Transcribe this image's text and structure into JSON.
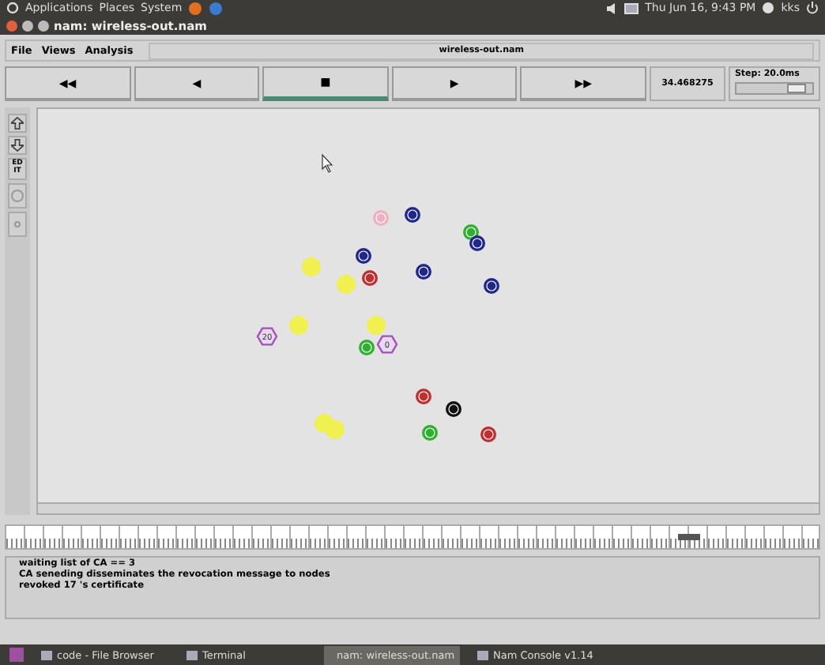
{
  "top_panel": {
    "menus": [
      "Applications",
      "Places",
      "System"
    ],
    "clock": "Thu Jun 16, 9:43 PM",
    "user": "kks"
  },
  "window": {
    "title": "nam: wireless-out.nam"
  },
  "menu_bar": {
    "items": [
      "File",
      "Views",
      "Analysis"
    ],
    "file_name": "wireless-out.nam"
  },
  "controls": [
    {
      "label": "◀◀",
      "selected": false
    },
    {
      "label": "◀",
      "selected": false
    },
    {
      "label": "■",
      "selected": true
    },
    {
      "label": "▶",
      "selected": false
    },
    {
      "label": "▶▶",
      "selected": false
    }
  ],
  "time": "34.468275",
  "step": {
    "label": "Step: 20.0ms",
    "level": 0.8
  },
  "side_tools": [
    {
      "kind": "zoom-in"
    },
    {
      "kind": "zoom-out"
    },
    {
      "kind": "edit",
      "label": "EDIT"
    },
    {
      "kind": "circle"
    },
    {
      "kind": "dot"
    }
  ],
  "nodes": [
    {
      "kind": "circle",
      "color": "#f0b0c0"
    },
    {
      "kind": "circle",
      "color": "#202890"
    },
    {
      "kind": "circle",
      "color": "#30b030"
    },
    {
      "kind": "circle",
      "color": "#202890"
    },
    {
      "kind": "circle",
      "color": "#202890"
    },
    {
      "kind": "circle",
      "color": "#c03030"
    },
    {
      "kind": "circle",
      "color": "#202890"
    },
    {
      "kind": "circle",
      "color": "#202890"
    },
    {
      "kind": "glow",
      "color": "#f0f050"
    },
    {
      "kind": "glow",
      "color": "#f0f050"
    },
    {
      "kind": "glow",
      "color": "#f0f050"
    },
    {
      "kind": "glow",
      "color": "#f0f050"
    },
    {
      "kind": "glow",
      "color": "#f0f050"
    },
    {
      "kind": "glow",
      "color": "#f0f050"
    },
    {
      "kind": "hexagon",
      "color": "#a050c0",
      "label": "20"
    },
    {
      "kind": "circle",
      "color": "#30b030"
    },
    {
      "kind": "hexagon",
      "color": "#a050c0",
      "label": "0"
    },
    {
      "kind": "circle",
      "color": "#c03030"
    },
    {
      "kind": "circle",
      "color": "#101010"
    },
    {
      "kind": "circle",
      "color": "#30b030"
    },
    {
      "kind": "circle",
      "color": "#c03030"
    }
  ],
  "timeline": {
    "level": 0.84
  },
  "log": [
    "waiting list of CA == 3",
    "CA seneding disseminates the revocation message to nodes",
    "revoked 17 's certificate"
  ],
  "taskbar": [
    {
      "label": "code - File Browser",
      "selected": false
    },
    {
      "label": "Terminal",
      "selected": false
    },
    {
      "label": "nam: wireless-out.nam",
      "selected": true
    },
    {
      "label": "Nam Console v1.14",
      "selected": false
    }
  ]
}
